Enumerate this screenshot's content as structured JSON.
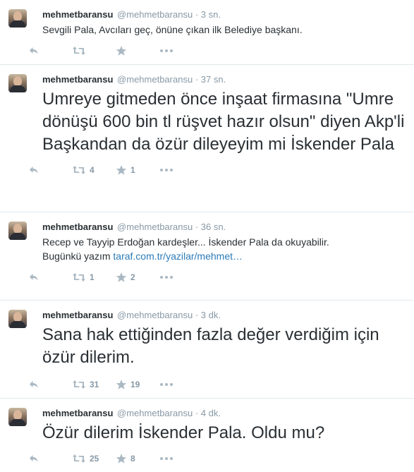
{
  "colors": {
    "text": "#292f33",
    "muted": "#8899a6",
    "link": "#2b7bb9",
    "divider": "#e1e8ed"
  },
  "icons": {
    "reply": "reply-icon",
    "retweet": "retweet-icon",
    "favorite": "star-icon",
    "more": "more-icon"
  },
  "tweets": [
    {
      "fullname": "mehmetbaransu",
      "handle": "@mehmetbaransu",
      "separator": "·",
      "time": "3 sn.",
      "text": "Sevgili Pala, Avcıları geç, önüne çıkan ilk Belediye başkanı.",
      "retweets": "",
      "favorites": ""
    },
    {
      "fullname": "mehmetbaransu",
      "handle": "@mehmetbaransu",
      "separator": "·",
      "time": "37 sn.",
      "text": "Umreye gitmeden önce inşaat firmasına \"Umre dönüşü 600 bin tl rüşvet hazır olsun\" diyen Akp'li Başkandan da özür dileyeyim mi İskender Pala",
      "retweets": "4",
      "favorites": "1"
    },
    {
      "fullname": "mehmetbaransu",
      "handle": "@mehmetbaransu",
      "separator": "·",
      "time": "36 sn.",
      "text_line1": "Recep ve Tayyip Erdoğan kardeşler... İskender Pala da okuyabilir.",
      "text_line2_prefix": "Bugünkü yazım",
      "link": "taraf.com.tr/yazilar/mehmet…",
      "retweets": "1",
      "favorites": "2"
    },
    {
      "fullname": "mehmetbaransu",
      "handle": "@mehmetbaransu",
      "separator": "·",
      "time": "3 dk.",
      "text": "Sana hak ettiğinden fazla değer verdiğim için özür dilerim.",
      "retweets": "31",
      "favorites": "19"
    },
    {
      "fullname": "mehmetbaransu",
      "handle": "@mehmetbaransu",
      "separator": "·",
      "time": "4 dk.",
      "text": "Özür dilerim İskender Pala. Oldu mu?",
      "retweets": "25",
      "favorites": "8"
    }
  ]
}
